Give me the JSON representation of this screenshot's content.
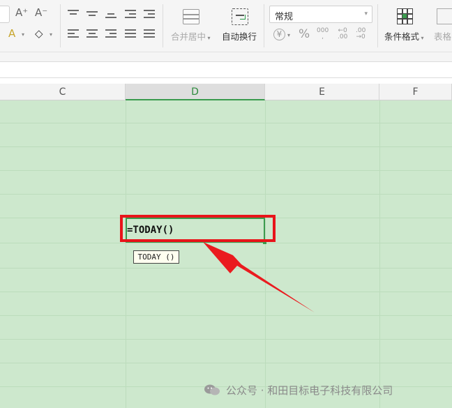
{
  "ribbon": {
    "font_size_inc": "A⁺",
    "font_size_dec": "A⁻",
    "font_color_glyph": "A",
    "eraser_glyph": "◇",
    "merge_center_label": "合并居中",
    "wrap_text_label": "自动换行",
    "number_format_value": "常规",
    "currency_glyph": "¥",
    "percent_glyph": "%",
    "thousands_glyph": "000",
    "decrease_decimal_top": "←0",
    "decrease_decimal_bottom": ".00",
    "increase_decimal_top": ".00",
    "increase_decimal_bottom": "→0",
    "conditional_format_label": "条件格式",
    "table_style_label": "表格"
  },
  "columns": [
    "C",
    "D",
    "E",
    "F"
  ],
  "active_column": "D",
  "cell": {
    "input_text": "=TODAY()",
    "tooltip_text": "TODAY ()"
  },
  "watermark": {
    "text": "公众号 · 和田目标电子科技有限公司"
  },
  "colors": {
    "grid_background": "#cde8cd",
    "active_accent": "#3b9b4e",
    "annotation_red": "#e8141a"
  }
}
